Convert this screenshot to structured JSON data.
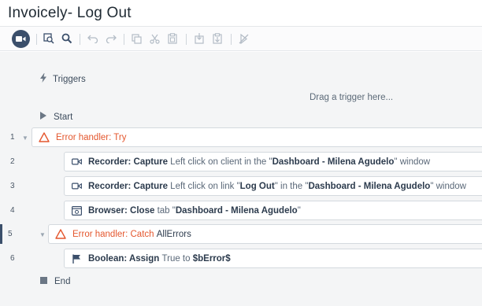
{
  "window": {
    "title": "Invoicely- Log Out"
  },
  "toolbar": {
    "buttons": [
      {
        "name": "record-icon"
      },
      {
        "name": "find-icon"
      },
      {
        "name": "search-icon"
      },
      {
        "name": "undo-icon"
      },
      {
        "name": "redo-icon"
      },
      {
        "name": "copy-icon"
      },
      {
        "name": "cut-icon"
      },
      {
        "name": "paste-icon"
      },
      {
        "name": "paste-before-icon"
      },
      {
        "name": "paste-after-icon"
      },
      {
        "name": "disable-icon"
      }
    ]
  },
  "flow": {
    "triggers_label": "Triggers",
    "drag_hint": "Drag a trigger here...",
    "start_label": "Start",
    "end_label": "End",
    "rows": [
      {
        "num": "1",
        "kind": "Error handler: Try"
      },
      {
        "num": "2",
        "action": "Recorder: Capture",
        "desc": "Left click on client in the",
        "q1": "\"",
        "target": "Dashboard - Milena Agudelo",
        "q2": "\"",
        "suffix": "window"
      },
      {
        "num": "3",
        "action": "Recorder: Capture",
        "desc": "Left click on link",
        "link_q1": "\"",
        "link": "Log Out",
        "link_q2": "\"",
        "mid": "in the",
        "q1": "\"",
        "target": "Dashboard - Milena Agudelo",
        "q2": "\"",
        "suffix": "window"
      },
      {
        "num": "4",
        "action": "Browser: Close",
        "desc": "tab",
        "q1": "\"",
        "target": "Dashboard - Milena Agudelo",
        "q2": "\""
      },
      {
        "num": "5",
        "kind": "Error handler: Catch",
        "arg": "AllErrors"
      },
      {
        "num": "6",
        "action": "Boolean: Assign",
        "desc": "True to",
        "var": "$bError$"
      }
    ]
  },
  "colors": {
    "accent": "#3b4f6b",
    "error": "#e4572e",
    "canvas": "#f4f5f6"
  }
}
